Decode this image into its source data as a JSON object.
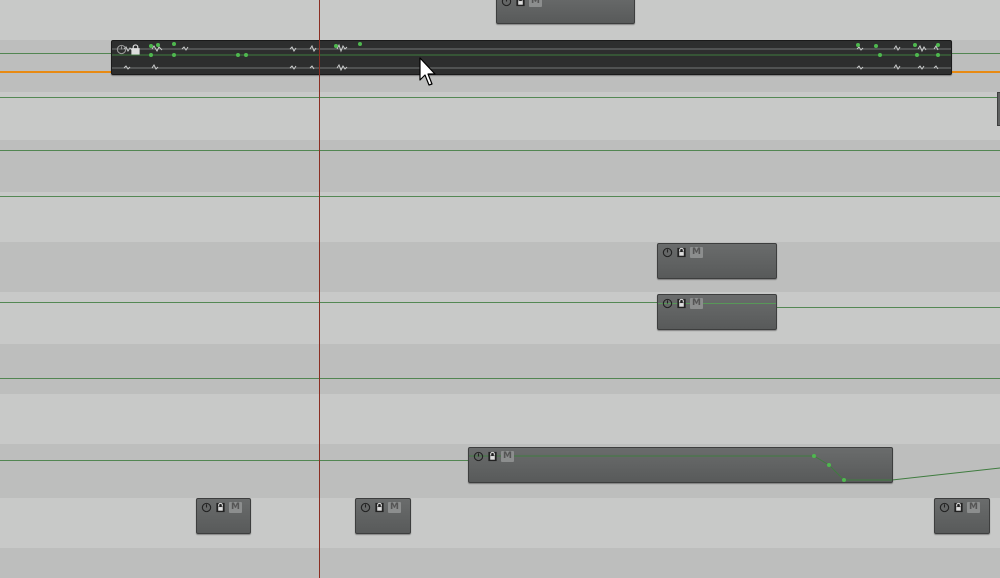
{
  "window": {
    "title": ""
  },
  "colors": {
    "lane_light": "#c8c9c8",
    "lane_dark": "#bdbebd",
    "automation_line": "#3f7c3f",
    "selected_track_line": "#e88a12",
    "playhead": "#8a2e22",
    "region_fill": "#5f6161",
    "selected_region_fill": "#2d2e2e",
    "node": "#4fb84f"
  },
  "region_controls": {
    "clock_icon": "clock-icon",
    "lock_icon": "lock-icon",
    "mute_label": "M"
  },
  "regions": [
    {
      "id": "region-top-partial",
      "mute_label": "M"
    },
    {
      "id": "region-selected-waveform",
      "mute_label": ""
    },
    {
      "id": "region-mid-1",
      "mute_label": "M"
    },
    {
      "id": "region-mid-2",
      "mute_label": "M"
    },
    {
      "id": "region-long-automation",
      "mute_label": "M"
    },
    {
      "id": "region-bottom-1",
      "mute_label": "M"
    },
    {
      "id": "region-bottom-2",
      "mute_label": "M"
    },
    {
      "id": "region-bottom-3",
      "mute_label": "M"
    }
  ]
}
